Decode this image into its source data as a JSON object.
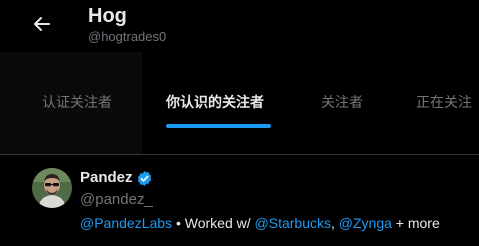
{
  "header": {
    "name": "Hog",
    "handle": "@hogtrades0"
  },
  "tabs": [
    {
      "label": "认证关注者",
      "active": false
    },
    {
      "label": "你认识的关注者",
      "active": true
    },
    {
      "label": "关注者",
      "active": false
    },
    {
      "label": "正在关注",
      "active": false
    }
  ],
  "user": {
    "name": "Pandez",
    "handle": "@pandez_",
    "verified_icon": "verified-badge-icon",
    "bio": {
      "link1": "@PandezLabs",
      "sep": " • ",
      "text1": "Worked w/ ",
      "link2": "@Starbucks",
      "comma": ", ",
      "link3": "@Zynga",
      "text2": " + more"
    }
  },
  "colors": {
    "accent": "#1d9bf0",
    "text_primary": "#e7e9ea",
    "text_secondary": "#71767b",
    "background": "#000000"
  }
}
